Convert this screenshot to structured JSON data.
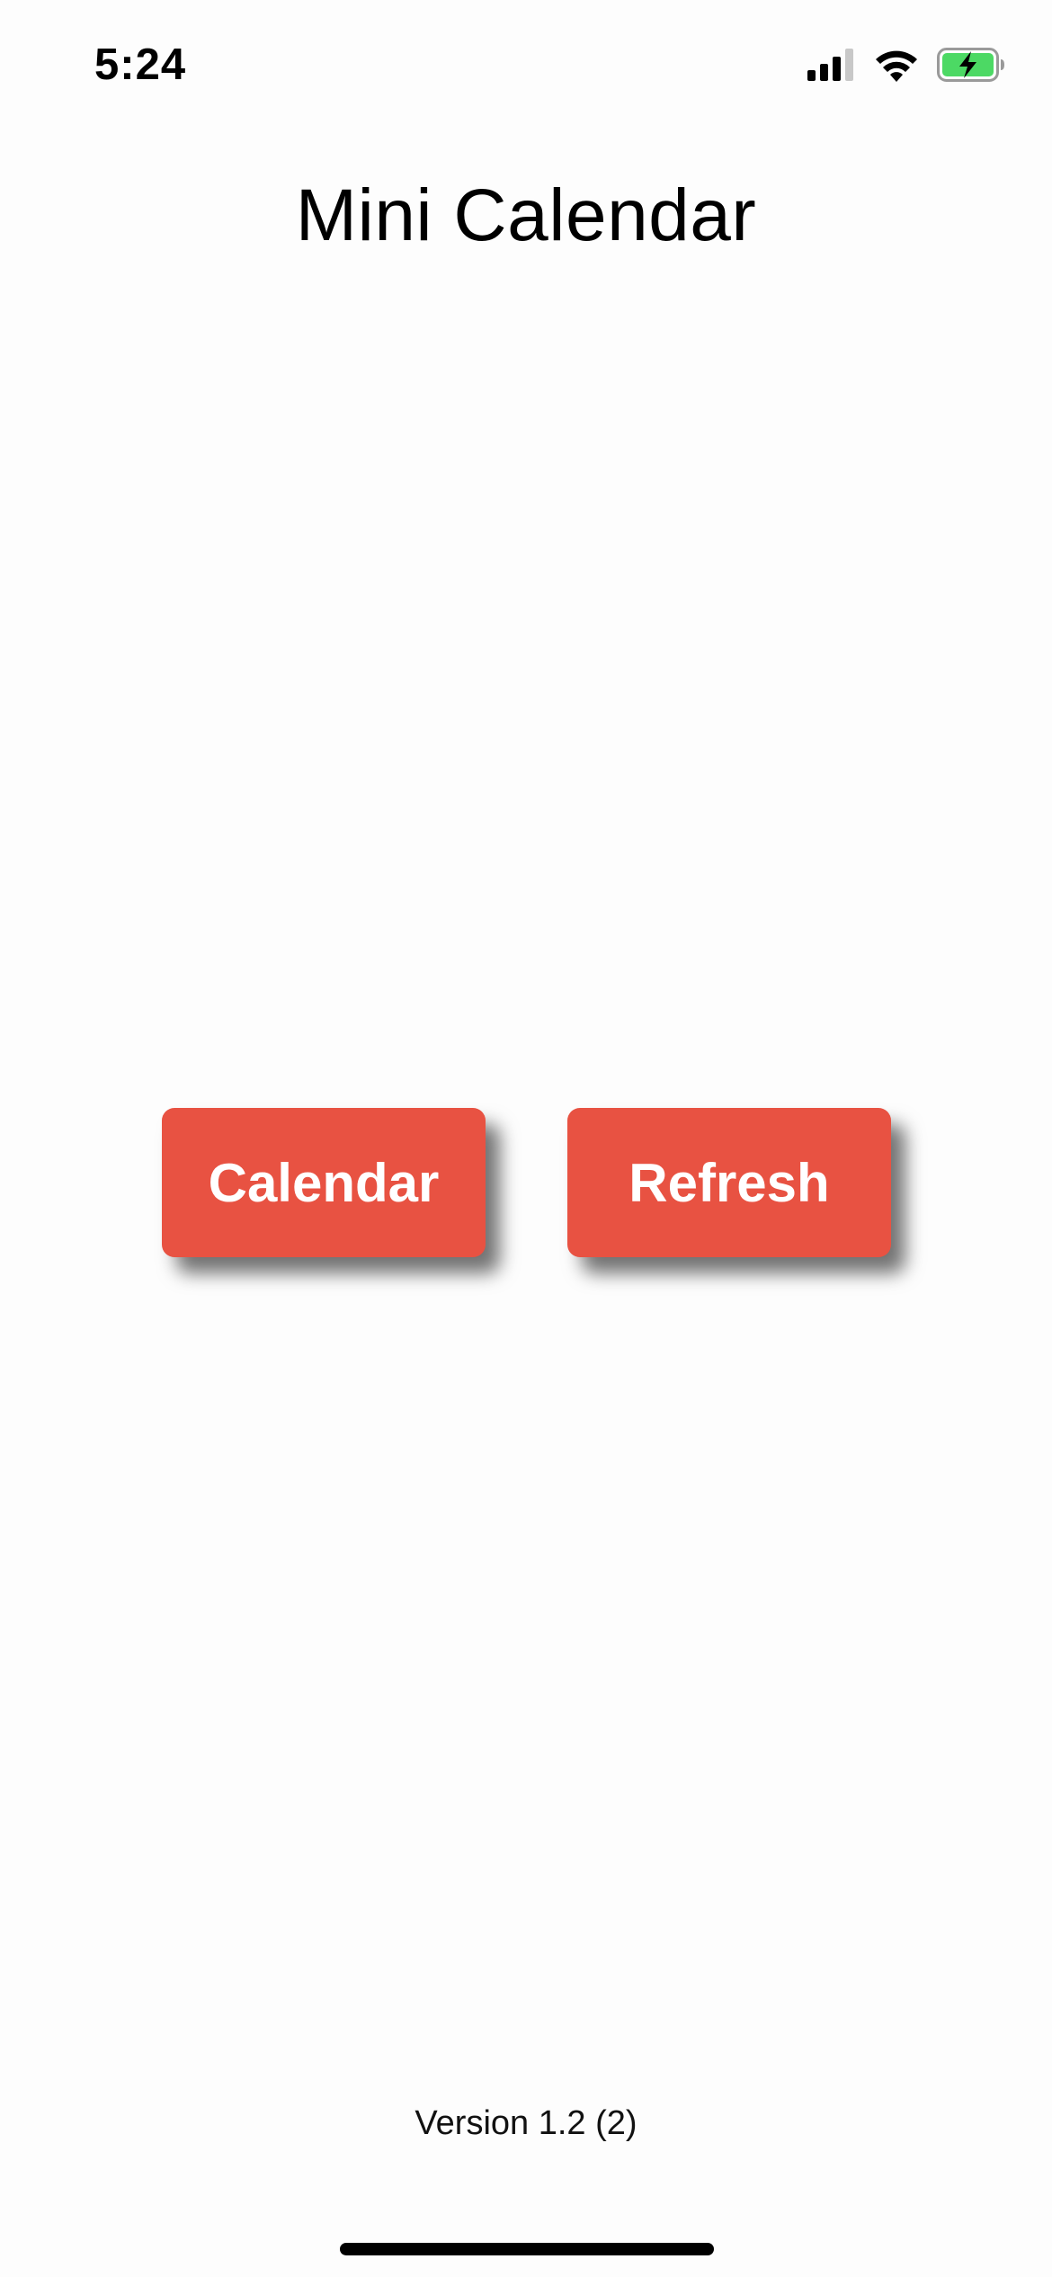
{
  "status_bar": {
    "time": "5:24",
    "icons": [
      "cellular-signal-icon",
      "wifi-icon",
      "battery-charging-icon"
    ],
    "battery_color": "#4cd964"
  },
  "header": {
    "title": "Mini Calendar"
  },
  "actions": {
    "calendar_label": "Calendar",
    "refresh_label": "Refresh",
    "button_color": "#e85242"
  },
  "footer": {
    "version": "Version 1.2 (2)"
  }
}
